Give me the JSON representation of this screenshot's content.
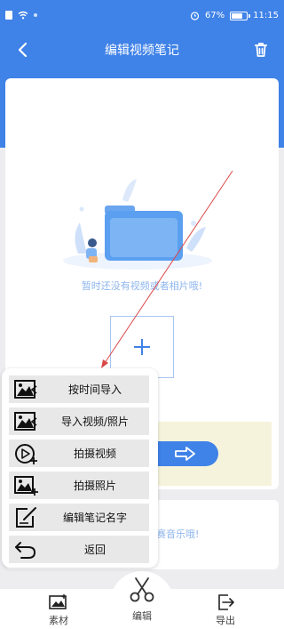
{
  "status_bar": {
    "battery_percent": "67%",
    "time": "11:15",
    "battery_level": 0.67
  },
  "app_bar": {
    "title": "编辑视频笔记",
    "back_icon": "chevron-left-icon",
    "trash_icon": "trash-icon"
  },
  "empty_state": {
    "message": "暂时还没有视频或者相片哦!"
  },
  "music": {
    "text_fragment": "赛音乐哦!"
  },
  "menu": {
    "items": [
      {
        "label": "按时间导入",
        "icon": "image-import-icon"
      },
      {
        "label": "导入视频/照片",
        "icon": "image-import-icon"
      },
      {
        "label": "拍摄视频",
        "icon": "video-record-icon"
      },
      {
        "label": "拍摄照片",
        "icon": "photo-add-icon"
      },
      {
        "label": "编辑笔记名字",
        "icon": "edit-note-icon"
      },
      {
        "label": "返回",
        "icon": "return-icon"
      }
    ]
  },
  "bottom_nav": {
    "items": [
      {
        "label": "素材",
        "icon": "image-add-icon"
      },
      {
        "label": "编辑",
        "icon": "scissors-icon"
      },
      {
        "label": "导出",
        "icon": "export-icon"
      }
    ]
  },
  "colors": {
    "primary": "#3f82e8",
    "muted_blue": "#8fb6ee",
    "annotation_red": "#d94848"
  }
}
